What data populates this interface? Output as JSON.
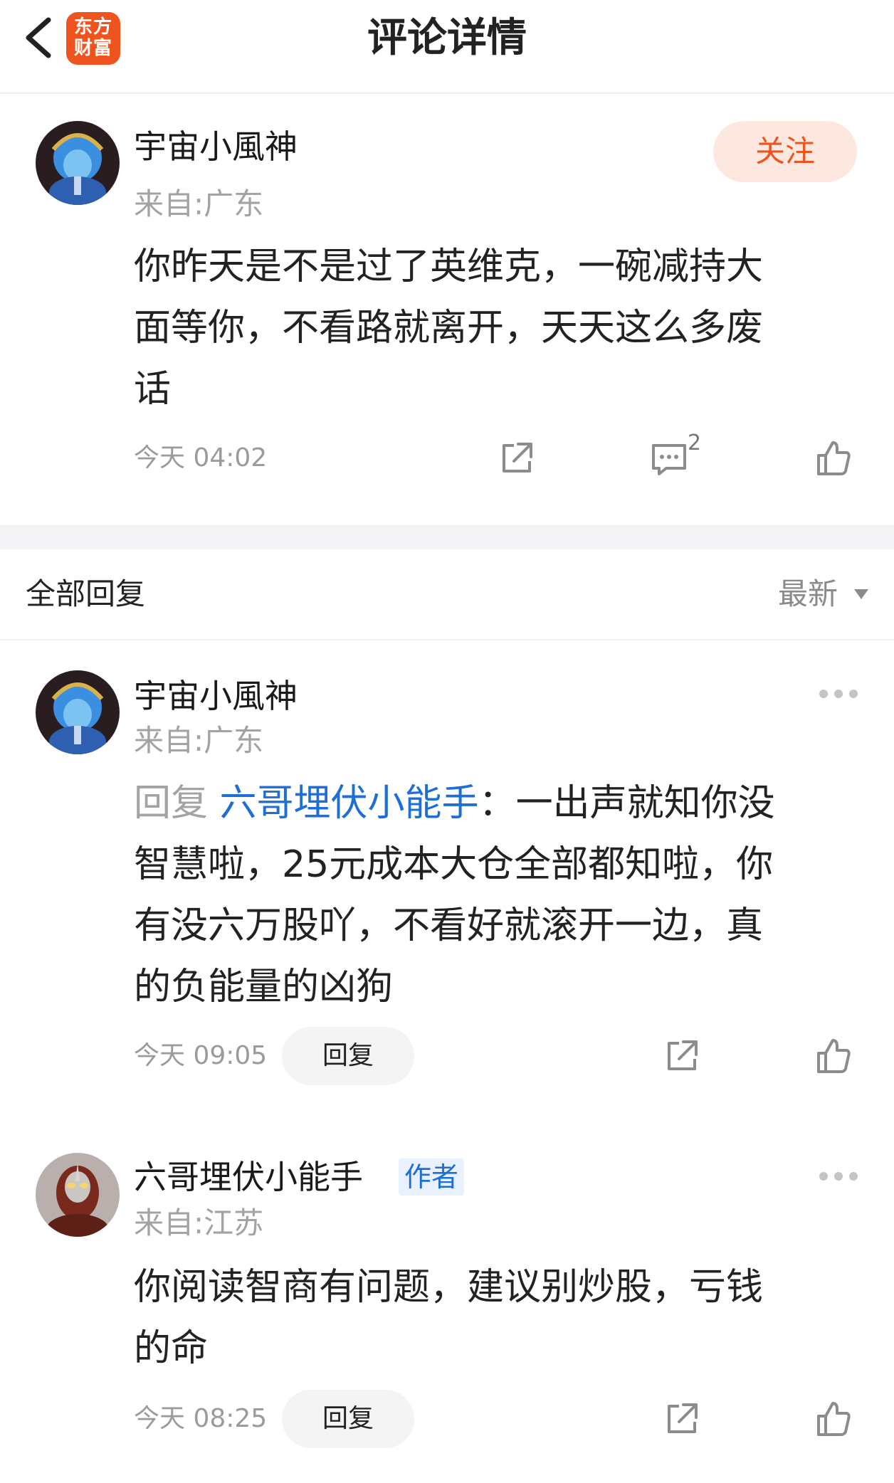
{
  "header": {
    "title": "评论详情",
    "logo_line1": "东方",
    "logo_line2": "财富"
  },
  "main_comment": {
    "username": "宇宙小風神",
    "location": "来自:广东",
    "follow_label": "关注",
    "text_line1": "你昨天是不是过了英维克，一碗减持大",
    "text_line2": "面等你，不看路就离开，天天这么多废",
    "text_line3": "话",
    "time": "今天 04:02",
    "reply_count": "2"
  },
  "replies_section": {
    "label": "全部回复",
    "sort_label": "最新"
  },
  "replies": [
    {
      "username": "宇宙小風神",
      "location": "来自:广东",
      "reply_prefix": "回复",
      "reply_to": "六哥埋伏小能手",
      "line1_rest": "：一出声就知你没",
      "line2": "智慧啦，25元成本大仓全部都知啦，你",
      "line3": "有没六万股吖，不看好就滚开一边，真",
      "line4": "的负能量的凶狗",
      "time": "今天 09:05",
      "reply_button": "回复"
    },
    {
      "username": "六哥埋伏小能手",
      "author_tag": "作者",
      "location": "来自:江苏",
      "line1": "你阅读智商有问题，建议别炒股，亏钱",
      "line2": "的命",
      "time": "今天 08:25",
      "reply_button": "回复"
    }
  ],
  "colors": {
    "brand": "#f0541e",
    "link_blue": "#1d6fd6",
    "follow_bg": "#fde8df"
  },
  "icons": [
    "back-arrow-icon",
    "share-icon",
    "comment-icon",
    "thumbs-up-icon",
    "more-dots-icon",
    "sort-caret-icon"
  ]
}
